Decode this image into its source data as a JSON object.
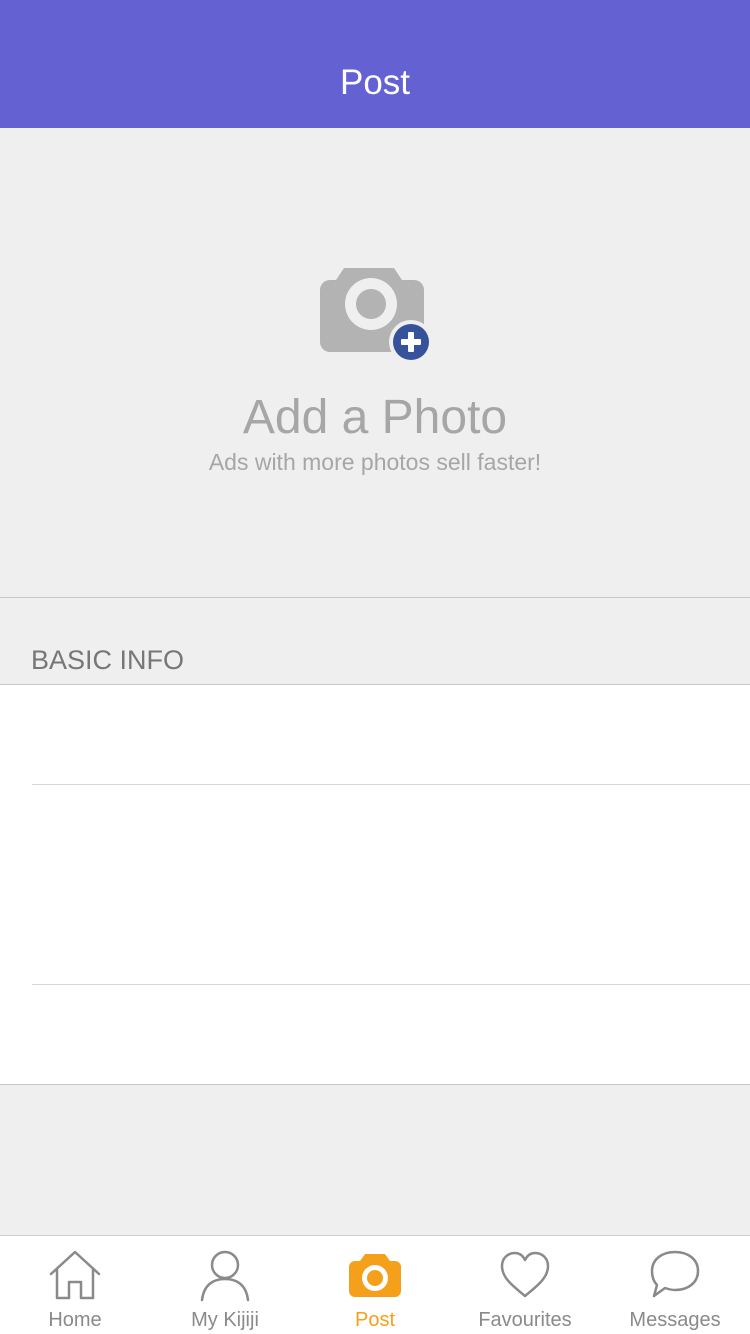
{
  "header": {
    "title": "Post",
    "action_label": ""
  },
  "photo": {
    "title": "Add a Photo",
    "subtitle": "Ads with more photos sell faster!",
    "icon": "camera-add-icon",
    "colors": {
      "camera": "#b3b3b3",
      "plus_badge": "#35529b"
    }
  },
  "sections": {
    "basic_info": "BASIC INFO"
  },
  "tabbar": {
    "items": [
      {
        "label": "Home",
        "icon": "home-icon"
      },
      {
        "label": "My Kijiji",
        "icon": "person-icon"
      },
      {
        "label": "Post",
        "icon": "camera-icon",
        "active": true
      },
      {
        "label": "Favourites",
        "icon": "heart-icon"
      },
      {
        "label": "Messages",
        "icon": "chat-bubble-icon"
      }
    ],
    "colors": {
      "active": "#f5a01a",
      "inactive": "#8a8a8a"
    }
  },
  "colors": {
    "header": "#6461d3",
    "background": "#efefef"
  }
}
